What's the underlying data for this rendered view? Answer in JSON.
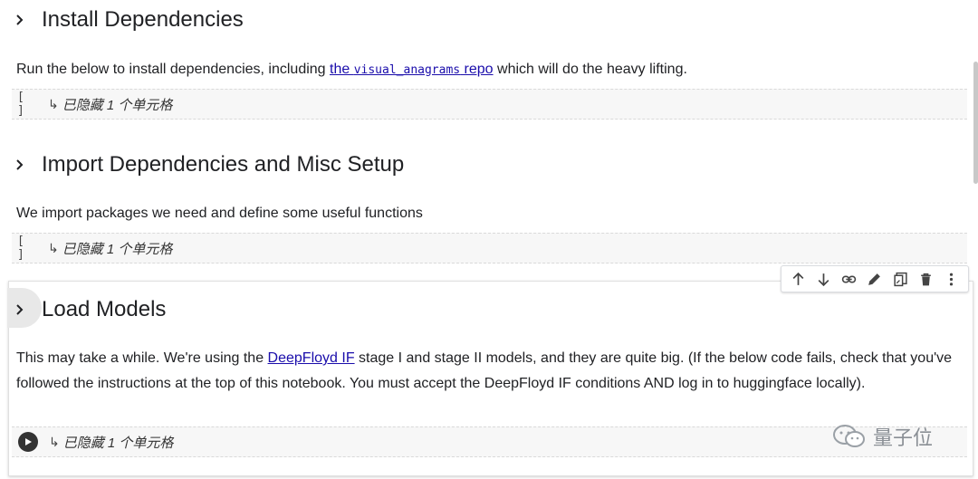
{
  "sections": [
    {
      "title": "Install Dependencies",
      "paragraph": {
        "before": "Run the below to install dependencies, including ",
        "link_prefix": "the ",
        "link_code": "visual_anagrams",
        "link_suffix": " repo",
        "after": " which will do the heavy lifting."
      },
      "hidden_cell": {
        "brackets": "[ ]",
        "arrow": "↳",
        "text": "已隐藏 1 个单元格"
      }
    },
    {
      "title": "Import Dependencies and Misc Setup",
      "paragraph": {
        "text": "We import packages we need and define some useful functions"
      },
      "hidden_cell": {
        "brackets": "[ ]",
        "arrow": "↳",
        "text": "已隐藏 1 个单元格"
      }
    },
    {
      "title": "Load Models",
      "paragraph": {
        "before": "This may take a while. We're using the ",
        "link": "DeepFloyd IF",
        "after": " stage I and stage II models, and they are quite big. (If the below code fails, check that you've followed the instructions at the top of this notebook. You must accept the DeepFloyd IF conditions AND log in to huggingface locally)."
      },
      "hidden_cell": {
        "arrow": "↳",
        "text": "已隐藏 1 个单元格"
      }
    }
  ],
  "toolbar": {
    "buttons": [
      "move-up-icon",
      "move-down-icon",
      "link-icon",
      "edit-icon",
      "mirror-cell-icon",
      "delete-icon",
      "more-icon"
    ]
  },
  "watermark": {
    "text": "量子位"
  },
  "colors": {
    "link": "#1a0dab",
    "hidden_bg": "#f7f7f7",
    "text": "#202124"
  }
}
